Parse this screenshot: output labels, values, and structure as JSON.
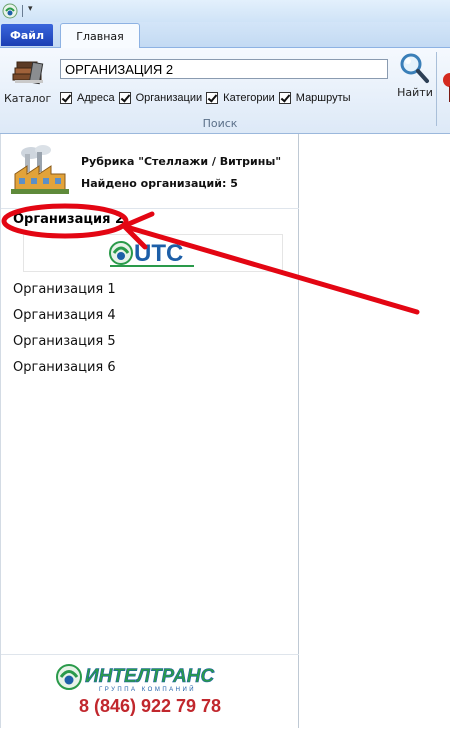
{
  "tabs": {
    "file": "Файл",
    "home": "Главная"
  },
  "ribbon": {
    "catalog_label": "Каталог",
    "search_value": "ОРГАНИЗАЦИЯ 2",
    "find_label": "Найти",
    "group_label": "Поиск",
    "checkboxes": [
      {
        "label": "Адреса",
        "checked": true
      },
      {
        "label": "Организации",
        "checked": true
      },
      {
        "label": "Категории",
        "checked": true
      },
      {
        "label": "Маршруты",
        "checked": true
      }
    ]
  },
  "panel": {
    "rubric_title": "Рубрика \"Стеллажи / Витрины\"",
    "found_count": "Найдено организаций: 5",
    "selected_org": "Организация 2",
    "selected_org_logo_text": "UTC",
    "orgs": [
      "Организация 1",
      "Организация 4",
      "Организация 5",
      "Организация 6"
    ],
    "footer_brand": "ИНТЕЛТРАНС",
    "footer_brand_sub": "ГРУППА КОМПАНИЙ",
    "footer_phone": "8 (846) 922 79 78"
  },
  "colors": {
    "file_tab": "#1b3fb4",
    "annotation": "#e30613",
    "phone": "#c1272d",
    "brand_green": "#2a9a4a",
    "brand_blue": "#1d5fa8"
  },
  "icons": {
    "app": "app-logo-icon",
    "catalog": "books-icon",
    "find": "magnifier-icon",
    "rubric": "factory-icon"
  }
}
